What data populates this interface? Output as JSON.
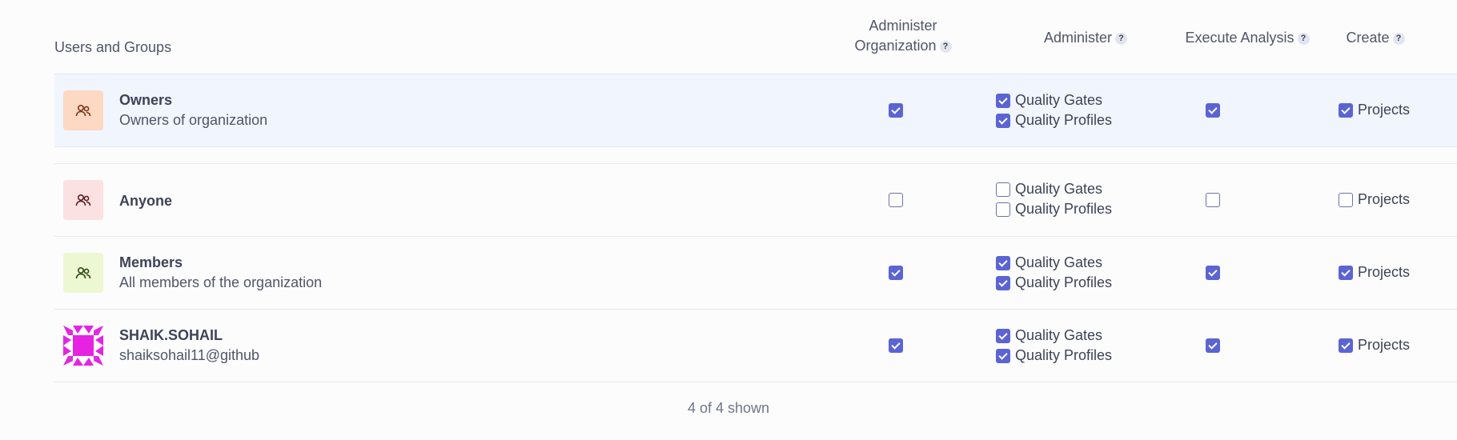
{
  "headers": {
    "users_groups": "Users and Groups",
    "admin_org_line1": "Administer",
    "admin_org_line2": "Organization",
    "administer": "Administer",
    "execute_analysis": "Execute Analysis",
    "create": "Create",
    "help_glyph": "?"
  },
  "rows": [
    {
      "name": "Owners",
      "desc": "Owners of organization",
      "avatar_color": "#fdd8c3",
      "icon_color": "#7a3818",
      "administer_org": true,
      "quality_gates": true,
      "quality_profiles": true,
      "execute_analysis": true,
      "projects": true
    },
    {
      "name": "Anyone",
      "desc": "",
      "avatar_color": "#fce1e2",
      "icon_color": "#5e1b1f",
      "administer_org": false,
      "quality_gates": false,
      "quality_profiles": false,
      "execute_analysis": false,
      "projects": false
    },
    {
      "name": "Members",
      "desc": "All members of the organization",
      "avatar_color": "#edf8d2",
      "icon_color": "#2c4a10",
      "administer_org": true,
      "quality_gates": true,
      "quality_profiles": true,
      "execute_analysis": true,
      "projects": true
    },
    {
      "name": "SHAIK.SOHAIL",
      "desc": "shaiksohail11@github",
      "avatar_color": "#e623e3",
      "icon_color": "#ffffff",
      "administer_org": true,
      "quality_gates": true,
      "quality_profiles": true,
      "execute_analysis": true,
      "projects": true
    }
  ],
  "labels": {
    "quality_gates": "Quality Gates",
    "quality_profiles": "Quality Profiles",
    "projects": "Projects"
  },
  "footer": "4 of 4 shown",
  "colors": {
    "accent": "#5b64d3",
    "row_highlight": "#f1f5fe"
  }
}
